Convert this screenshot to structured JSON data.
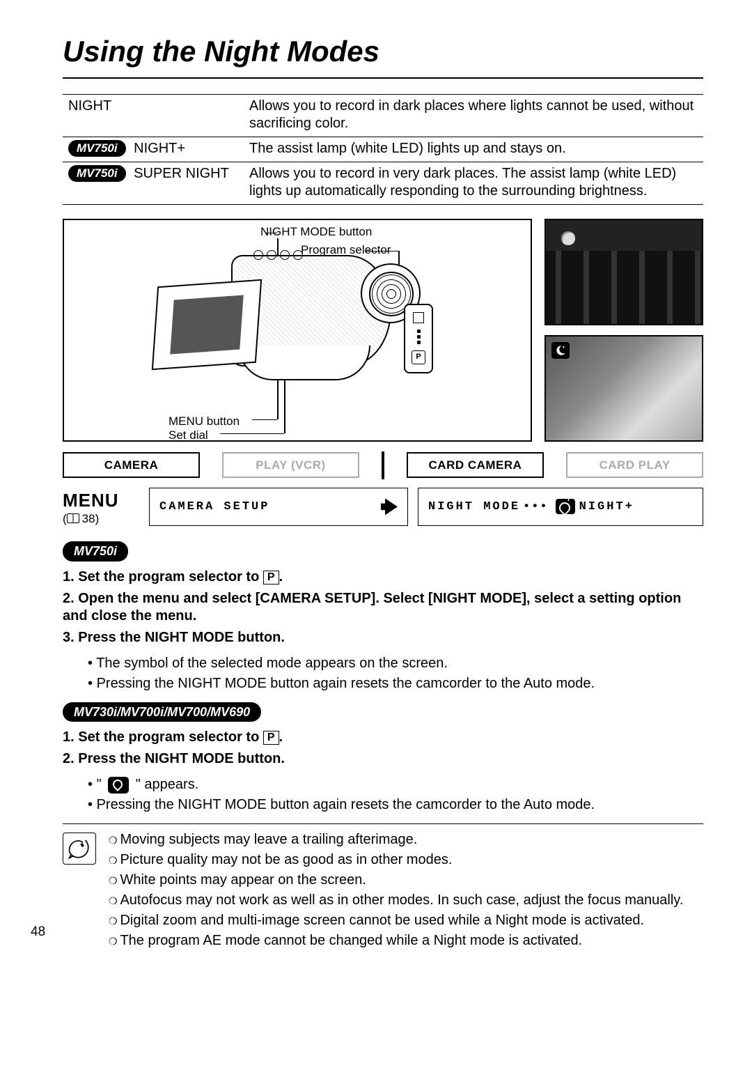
{
  "page_title": "Using the Night Modes",
  "page_number": "48",
  "modes_table": [
    {
      "label": "NIGHT",
      "badge": "",
      "desc": "Allows you to record in dark places where lights cannot be used, without sacrificing color."
    },
    {
      "label": "NIGHT+",
      "badge": "MV750i",
      "desc": "The assist lamp (white LED) lights up and stays on."
    },
    {
      "label": "SUPER NIGHT",
      "badge": "MV750i",
      "desc": "Allows you to record in very dark places. The assist lamp (white LED) lights up automatically responding to the surrounding brightness."
    }
  ],
  "diagram_callouts": {
    "night_mode_button": "NIGHT MODE button",
    "program_selector": "Program selector",
    "menu_button": "MENU button",
    "set_dial": "Set dial"
  },
  "mode_bar": {
    "camera": "CAMERA",
    "play_vcr": "PLAY (VCR)",
    "card_camera": "CARD CAMERA",
    "card_play": "CARD PLAY"
  },
  "menu_box": {
    "title": "MENU",
    "page_ref": "38",
    "left": "CAMERA SETUP",
    "right_a": "NIGHT MODE",
    "right_dots": "•••",
    "right_b": "NIGHT+"
  },
  "section1": {
    "badge": "MV750i",
    "steps": [
      {
        "n": "1.",
        "t": "Set the program selector to ",
        "after": "."
      },
      {
        "n": "2.",
        "t": "Open the menu and select [CAMERA SETUP]. Select [NIGHT MODE], select a setting option and close the menu."
      },
      {
        "n": "3.",
        "t": "Press the NIGHT MODE button."
      }
    ],
    "sub": [
      "The symbol of the selected mode appears on the screen.",
      "Pressing the NIGHT MODE button again resets the camcorder to the Auto mode."
    ]
  },
  "section2": {
    "badge": "MV730i/MV700i/MV700/MV690",
    "steps": [
      {
        "n": "1.",
        "t": "Set the program selector to ",
        "after": "."
      },
      {
        "n": "2.",
        "t": "Press the NIGHT MODE button."
      }
    ],
    "sub_a_before": "\" ",
    "sub_a_after": " \" appears.",
    "sub_b": "Pressing the NIGHT MODE button again resets the camcorder to the Auto mode."
  },
  "notes": [
    "Moving subjects may leave a trailing afterimage.",
    "Picture quality may not be as good as in other modes.",
    "White points may appear on the screen.",
    "Autofocus may not work as well as in other modes. In such case, adjust the focus manually.",
    "Digital zoom and multi-image screen cannot be used while a Night mode is activated.",
    "The program AE mode cannot be changed while a Night mode is activated."
  ],
  "p_icon_text": "P"
}
